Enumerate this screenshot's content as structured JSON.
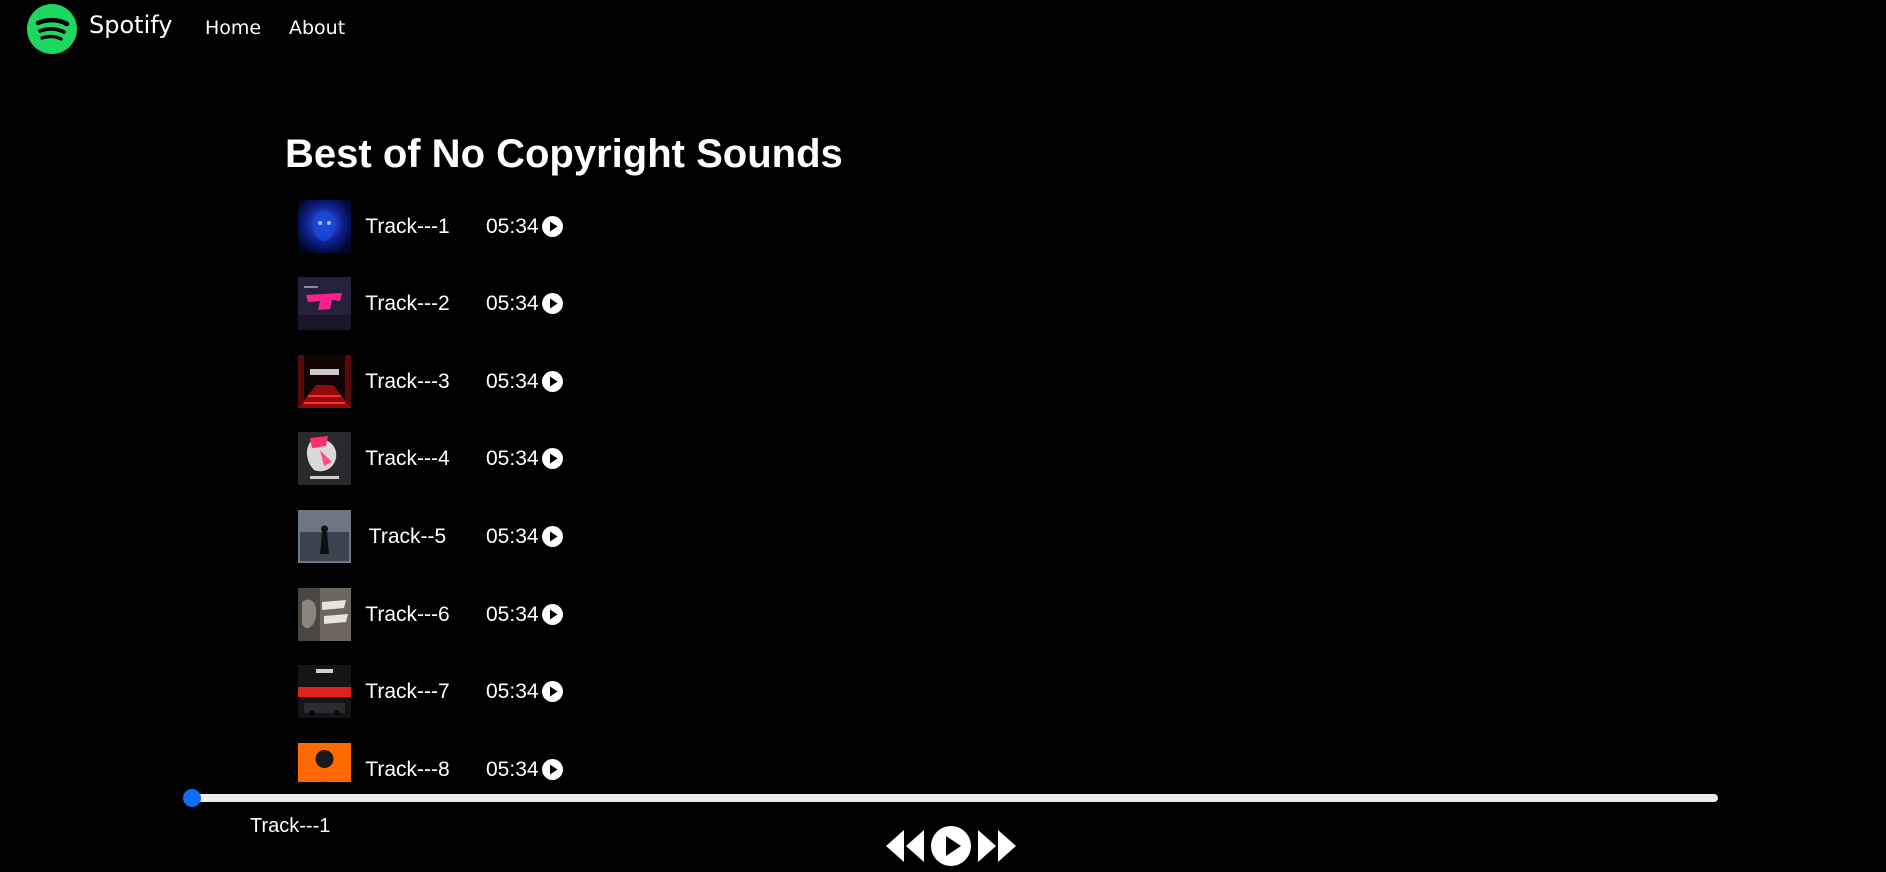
{
  "nav": {
    "brand": "Spotify",
    "links": [
      "Home",
      "About"
    ]
  },
  "playlist": {
    "title": "Best of No Copyright Sounds",
    "songs": [
      {
        "name": "Track---1",
        "duration": "05:34"
      },
      {
        "name": "Track---2",
        "duration": "05:34"
      },
      {
        "name": "Track---3",
        "duration": "05:34"
      },
      {
        "name": "Track---4",
        "duration": "05:34"
      },
      {
        "name": "Track--5",
        "duration": "05:34"
      },
      {
        "name": "Track---6",
        "duration": "05:34"
      },
      {
        "name": "Track---7",
        "duration": "05:34"
      },
      {
        "name": "Track---8",
        "duration": "05:34"
      }
    ]
  },
  "player": {
    "current_track": "Track---1",
    "progress_percent": 0
  },
  "colors": {
    "brand_green": "#1ED760",
    "background": "#000000",
    "accent_blue": "#0D6EFD",
    "track_bar": "#ECECEC"
  },
  "icons": {
    "logo": "spotify-logo-icon",
    "item_play": "play-circle-icon",
    "prev": "backward-icon",
    "play": "play-circle-icon",
    "next": "forward-icon"
  }
}
